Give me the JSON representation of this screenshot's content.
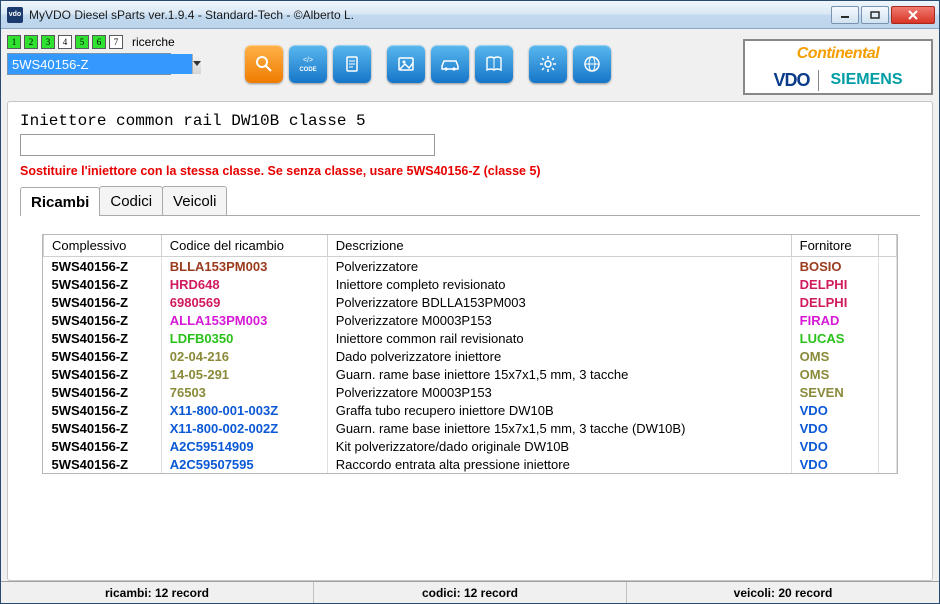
{
  "title": "MyVDO Diesel sParts  ver.1.9.4  -  Standard-Tech  -   ©Alberto L.",
  "history": {
    "label": "ricerche",
    "items": [
      "1",
      "2",
      "3",
      "4",
      "5",
      "6",
      "7"
    ],
    "active": [
      0,
      1,
      2,
      4,
      5
    ]
  },
  "search": {
    "value": "5WS40156-Z"
  },
  "logos": {
    "continental": "Continental",
    "vdo": "VDO",
    "siemens": "SIEMENS"
  },
  "item": {
    "title": "Iniettore common rail DW10B classe 5",
    "input": "",
    "warning": "Sostituire l'iniettore con la stessa classe. Se senza classe, usare 5WS40156-Z (classe 5)"
  },
  "tabs": [
    {
      "label": "Ricambi",
      "active": true
    },
    {
      "label": "Codici",
      "active": false
    },
    {
      "label": "Veicoli",
      "active": false
    }
  ],
  "table": {
    "headers": [
      "Complessivo",
      "Codice del ricambio",
      "Descrizione",
      "Fornitore"
    ],
    "rows": [
      {
        "comp": "5WS40156-Z",
        "code": "BLLA153PM003",
        "desc": "Polverizzatore",
        "supp": "BOSIO",
        "codeClass": "c-brown",
        "suppClass": "c-brown"
      },
      {
        "comp": "5WS40156-Z",
        "code": "HRD648",
        "desc": "Iniettore completo revisionato",
        "supp": "DELPHI",
        "codeClass": "c-crimson",
        "suppClass": "c-crimson"
      },
      {
        "comp": "5WS40156-Z",
        "code": "6980569",
        "desc": "Polverizzatore BDLLA153PM003",
        "supp": "DELPHI",
        "codeClass": "c-crimson",
        "suppClass": "c-crimson"
      },
      {
        "comp": "5WS40156-Z",
        "code": "ALLA153PM003",
        "desc": "Polverizzatore M0003P153",
        "supp": "FIRAD",
        "codeClass": "c-magenta",
        "suppClass": "c-magenta"
      },
      {
        "comp": "5WS40156-Z",
        "code": "LDFB0350",
        "desc": "Iniettore common rail revisionato",
        "supp": "LUCAS",
        "codeClass": "c-lime",
        "suppClass": "c-lime"
      },
      {
        "comp": "5WS40156-Z",
        "code": "02-04-216",
        "desc": "Dado polverizzatore iniettore",
        "supp": "OMS",
        "codeClass": "c-olive",
        "suppClass": "c-olive"
      },
      {
        "comp": "5WS40156-Z",
        "code": "14-05-291",
        "desc": "Guarn. rame base iniettore 15x7x1,5 mm, 3 tacche",
        "supp": "OMS",
        "codeClass": "c-olive",
        "suppClass": "c-olive"
      },
      {
        "comp": "5WS40156-Z",
        "code": "76503",
        "desc": "Polverizzatore M0003P153",
        "supp": "SEVEN",
        "codeClass": "c-olive",
        "suppClass": "c-olive"
      },
      {
        "comp": "5WS40156-Z",
        "code": "X11-800-001-003Z",
        "desc": "Graffa tubo recupero iniettore DW10B",
        "supp": "VDO",
        "codeClass": "c-blue",
        "suppClass": "c-blue"
      },
      {
        "comp": "5WS40156-Z",
        "code": "X11-800-002-002Z",
        "desc": "Guarn. rame base iniettore 15x7x1,5 mm, 3 tacche (DW10B)",
        "supp": "VDO",
        "codeClass": "c-blue",
        "suppClass": "c-blue"
      },
      {
        "comp": "5WS40156-Z",
        "code": "A2C59514909",
        "desc": "Kit polverizzatore/dado originale DW10B",
        "supp": "VDO",
        "codeClass": "c-blue",
        "suppClass": "c-blue"
      },
      {
        "comp": "5WS40156-Z",
        "code": "A2C59507595",
        "desc": "Raccordo entrata alta pressione iniettore",
        "supp": "VDO",
        "codeClass": "c-blue",
        "suppClass": "c-blue"
      }
    ]
  },
  "status": {
    "ricambi": "ricambi: 12 record",
    "codici": "codici: 12 record",
    "veicoli": "veicoli: 20 record"
  }
}
